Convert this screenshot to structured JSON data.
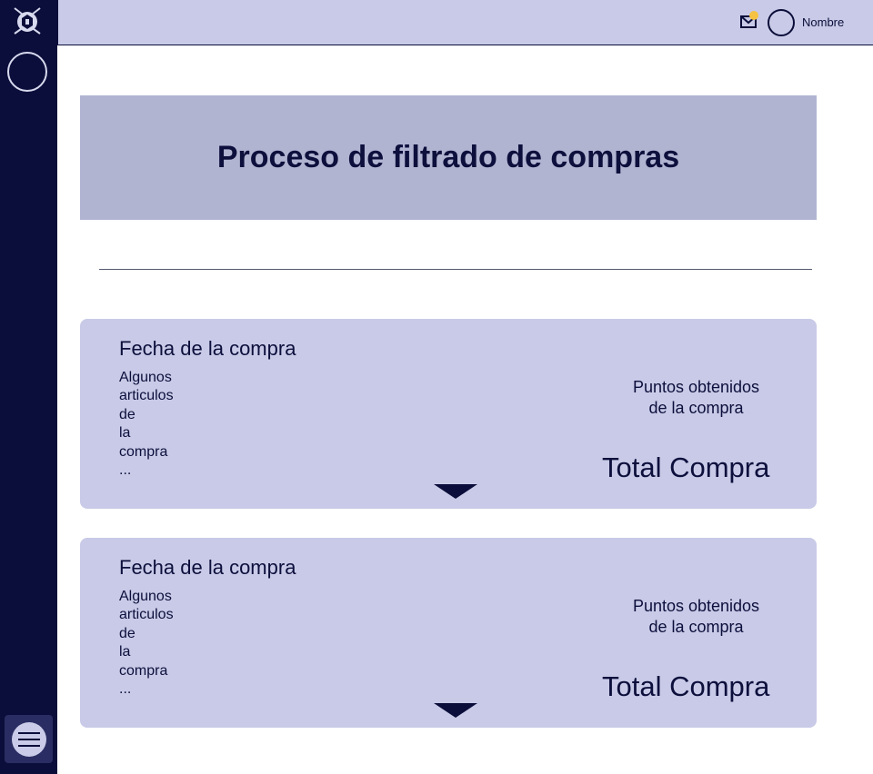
{
  "header": {
    "user_name": "Nombre",
    "icons": {
      "mail": "mail-icon",
      "notification": "notification-dot",
      "user": "user-avatar"
    },
    "colors": {
      "notification": "#f5c242"
    }
  },
  "sidebar": {
    "icons": {
      "logo": "app-logo-icon",
      "avatar": "profile-avatar",
      "menu": "hamburger-menu-icon"
    },
    "colors": {
      "background": "#0b0d3a"
    }
  },
  "main": {
    "title": "Proceso de filtrado de compras",
    "purchases": [
      {
        "date": "Fecha de la compra",
        "items": "Algunos\narticulos\nde\nla\ncompra\n...",
        "points": "Puntos obtenidos\nde la compra",
        "total": "Total Compra"
      },
      {
        "date": "Fecha de la compra",
        "items": "Algunos\narticulos\nde\nla\ncompra\n...",
        "points": "Puntos obtenidos\nde la compra",
        "total": "Total Compra"
      }
    ]
  },
  "colors": {
    "accent": "#c8cae7",
    "banner": "#b1b4d1",
    "text": "#0d0f3c"
  }
}
